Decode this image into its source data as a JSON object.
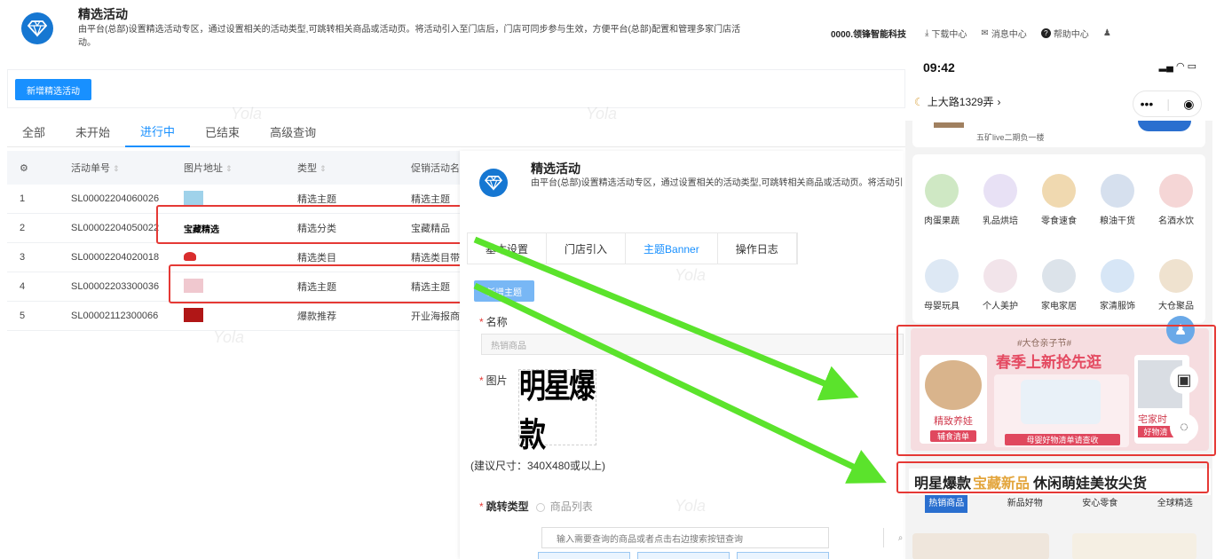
{
  "header": {
    "title": "精选活动",
    "description": "由平台(总部)设置精选活动专区，通过设置相关的活动类型,可跳转相关商品或活动页。将活动引入至门店后，门店可同步参与生效，方便平台(总部)配置和管理多家门店活动。",
    "company": "0000.领锋智能科技",
    "links": [
      "下载中心",
      "消息中心",
      "帮助中心"
    ]
  },
  "toolbar": {
    "add_button": "新增精选活动"
  },
  "tabs": [
    "全部",
    "未开始",
    "进行中",
    "已结束",
    "高级查询"
  ],
  "table": {
    "columns": [
      "活动单号",
      "图片地址",
      "类型",
      "促销活动名称"
    ],
    "rows": [
      {
        "idx": "1",
        "code": "SL00002204060026",
        "type": "精选主题",
        "promo": "精选主题"
      },
      {
        "idx": "2",
        "code": "SL00002204050022",
        "type": "精选分类",
        "promo": "宝藏精品"
      },
      {
        "idx": "3",
        "code": "SL00002204020018",
        "type": "精选类目",
        "promo": "精选类目带"
      },
      {
        "idx": "4",
        "code": "SL00002203300036",
        "type": "精选主题",
        "promo": "精选主题"
      },
      {
        "idx": "5",
        "code": "SL00002112300066",
        "type": "爆款推荐",
        "promo": "开业海报商品"
      }
    ],
    "thumb_text": "宝藏精选"
  },
  "form": {
    "title": "精选活动",
    "description": "由平台(总部)设置精选活动专区，通过设置相关的活动类型,可跳转相关商品或活动页。将活动引入至门店后，门店可同步参与生效，方便平台(总部)配置和管理多家门店活动。",
    "tabs": [
      "基本设置",
      "门店引入",
      "主题Banner",
      "操作日志"
    ],
    "add_button": "新增主题",
    "name_label": "名称",
    "name_value": "热销商品",
    "image_label": "图片",
    "image_text": "明星爆款",
    "size_hint": "(建议尺寸：340X480或以上)",
    "jump_label": "跳转类型",
    "jump_option": "商品列表",
    "search_placeholder": "输入需要查询的商品或者点击右边搜索按钮查询"
  },
  "phone": {
    "time": "09:42",
    "store": "上大路1329弄",
    "address": "五矿live二期负一楼",
    "categories": [
      "肉蛋果蔬",
      "乳品烘培",
      "零食速食",
      "粮油干货",
      "名酒水饮",
      "母婴玩具",
      "个人美护",
      "家电家居",
      "家清服饰",
      "大仓聚品"
    ],
    "banner": {
      "tag": "#大仓亲子节#",
      "title": "春季上新抢先逛",
      "left_title": "精致养娃",
      "left_sub": "辅食清单",
      "mid_sub": "母婴好物清单请查收",
      "right_title": "宅家时",
      "right_sub": "好物清"
    },
    "strip": {
      "a": "明星爆款",
      "b": "宝藏新品",
      "c": "休闲萌娃美妆尖货"
    },
    "subtabs": [
      "热销商品",
      "新品好物",
      "安心零食",
      "全球精选"
    ]
  },
  "watermark": "Yola",
  "colors": {
    "primary": "#1890ff",
    "highlight": "#e53935",
    "arrow": "#5be32c"
  }
}
